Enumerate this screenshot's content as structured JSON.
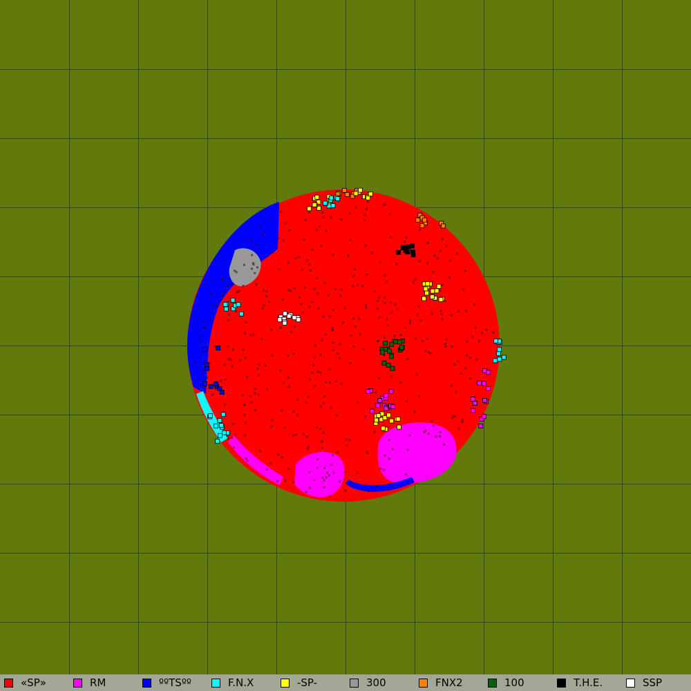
{
  "map": {
    "background_color": "#627a0b",
    "grid_color": "#2f4a0c",
    "territory_region": "circular-cluster"
  },
  "legend": {
    "items": [
      {
        "label": "«SP»",
        "color": "#ff0000",
        "icon": "red-square"
      },
      {
        "label": "RM",
        "color": "#ff00ff",
        "icon": "magenta-square"
      },
      {
        "label": "ººTSºº",
        "color": "#0000ff",
        "icon": "blue-square"
      },
      {
        "label": "F.N.X",
        "color": "#00ffff",
        "icon": "cyan-square"
      },
      {
        "label": "-SP-",
        "color": "#ffff00",
        "icon": "yellow-square"
      },
      {
        "label": "300",
        "color": "#999999",
        "icon": "gray-square"
      },
      {
        "label": "FNX2",
        "color": "#ff7f00",
        "icon": "orange-square"
      },
      {
        "label": "100",
        "color": "#006400",
        "icon": "dark-green-square"
      },
      {
        "label": "T.H.E.",
        "color": "#000000",
        "icon": "black-square"
      },
      {
        "label": "SSP",
        "color": "#ffffff",
        "icon": "white-square"
      }
    ]
  }
}
